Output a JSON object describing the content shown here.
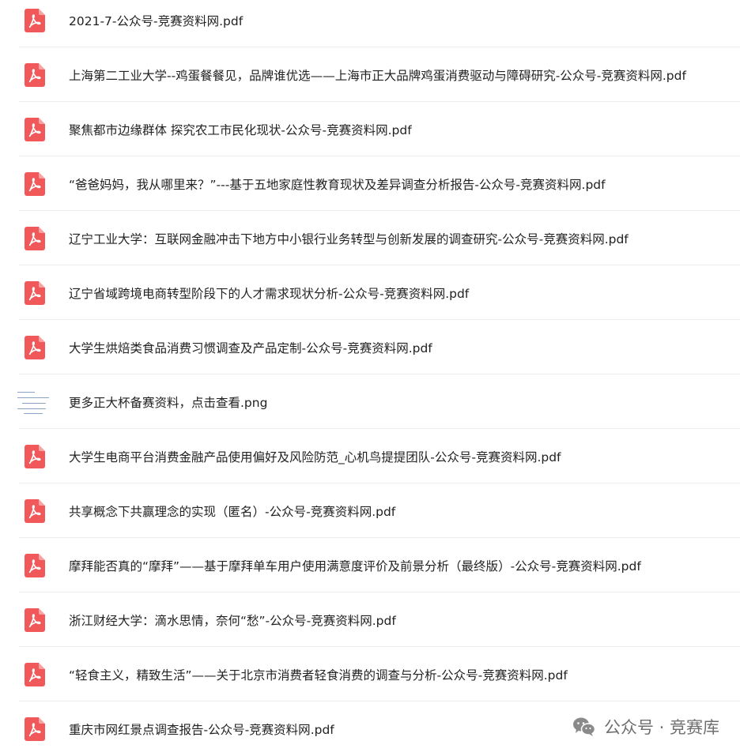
{
  "files": [
    {
      "name": "2021-7-公众号-竞赛资料网.pdf",
      "type": "pdf",
      "icon": "pdf-icon"
    },
    {
      "name": "上海第二工业大学--鸡蛋餐餐见，品牌谁优选——上海市正大品牌鸡蛋消费驱动与障碍研究-公众号-竞赛资料网.pdf",
      "type": "pdf",
      "icon": "pdf-icon"
    },
    {
      "name": "聚焦都市边缘群体 探究农工市民化现状-公众号-竞赛资料网.pdf",
      "type": "pdf",
      "icon": "pdf-icon"
    },
    {
      "name": "“爸爸妈妈，我从哪里来？”---基于五地家庭性教育现状及差异调查分析报告-公众号-竞赛资料网.pdf",
      "type": "pdf",
      "icon": "pdf-icon"
    },
    {
      "name": "辽宁工业大学：互联网金融冲击下地方中小银行业务转型与创新发展的调查研究-公众号-竞赛资料网.pdf",
      "type": "pdf",
      "icon": "pdf-icon"
    },
    {
      "name": "辽宁省域跨境电商转型阶段下的人才需求现状分析-公众号-竞赛资料网.pdf",
      "type": "pdf",
      "icon": "pdf-icon"
    },
    {
      "name": "大学生烘焙类食品消费习惯调查及产品定制-公众号-竞赛资料网.pdf",
      "type": "pdf",
      "icon": "pdf-icon"
    },
    {
      "name": "更多正大杯备赛资料，点击查看.png",
      "type": "png",
      "icon": "image-thumbnail"
    },
    {
      "name": "大学生电商平台消费金融产品使用偏好及风险防范_心机鸟提提团队-公众号-竞赛资料网.pdf",
      "type": "pdf",
      "icon": "pdf-icon"
    },
    {
      "name": "共享概念下共赢理念的实现（匿名）-公众号-竞赛资料网.pdf",
      "type": "pdf",
      "icon": "pdf-icon"
    },
    {
      "name": "摩拜能否真的“摩拜”——基于摩拜单车用户使用满意度评价及前景分析（最终版）-公众号-竞赛资料网.pdf",
      "type": "pdf",
      "icon": "pdf-icon"
    },
    {
      "name": "浙江财经大学：滴水思情，奈何“愁”-公众号-竞赛资料网.pdf",
      "type": "pdf",
      "icon": "pdf-icon"
    },
    {
      "name": "“轻食主义，精致生活”——关于北京市消费者轻食消费的调查与分析-公众号-竞赛资料网.pdf",
      "type": "pdf",
      "icon": "pdf-icon"
    },
    {
      "name": "重庆市网红景点调查报告-公众号-竞赛资料网.pdf",
      "type": "pdf",
      "icon": "pdf-icon"
    }
  ],
  "watermark": {
    "text": "公众号 · 竞赛库",
    "icon": "wechat-icon"
  },
  "colors": {
    "pdf_icon": "#f0585a",
    "text": "#222222",
    "divider": "#ececec",
    "watermark": "#6f6f6f"
  }
}
